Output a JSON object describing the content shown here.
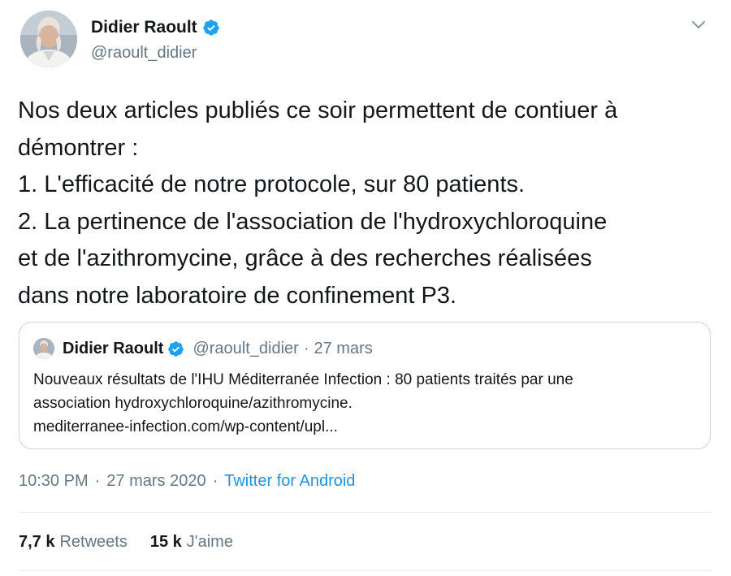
{
  "tweet": {
    "author": {
      "name": "Didier Raoult",
      "handle": "@raoult_didier",
      "verified": true
    },
    "text_lines": [
      "Nos deux articles publiés ce soir permettent de contiuer à",
      "démontrer :",
      "1. L'efficacité de notre protocole, sur 80 patients.",
      "2. La pertinence de l'association de l'hydroxychloroquine",
      "et de l'azithromycine, grâce à des recherches réalisées",
      "dans notre laboratoire de confinement P3."
    ],
    "quoted": {
      "name": "Didier Raoult",
      "handle": "@raoult_didier",
      "separator": "·",
      "date": "27 mars",
      "text_lines": [
        "Nouveaux résultats de l'IHU Méditerranée Infection : 80 patients traités par une",
        "association hydroxychloroquine/azithromycine.",
        "mediterranee-infection.com/wp-content/upl..."
      ]
    },
    "meta": {
      "time": "10:30 PM",
      "separator": "·",
      "date": "27 mars 2020",
      "source": "Twitter for Android"
    },
    "stats": {
      "retweets_count": "7,7 k",
      "retweets_label": "Retweets",
      "likes_count": "15 k",
      "likes_label": "J'aime"
    }
  },
  "icons": {
    "verified": "verified-badge-icon",
    "caret": "chevron-down-icon"
  },
  "colors": {
    "text": "#14171a",
    "secondary": "#657786",
    "link": "#1b95e0",
    "verified": "#1da1f2",
    "border": "#ccd6dd"
  }
}
